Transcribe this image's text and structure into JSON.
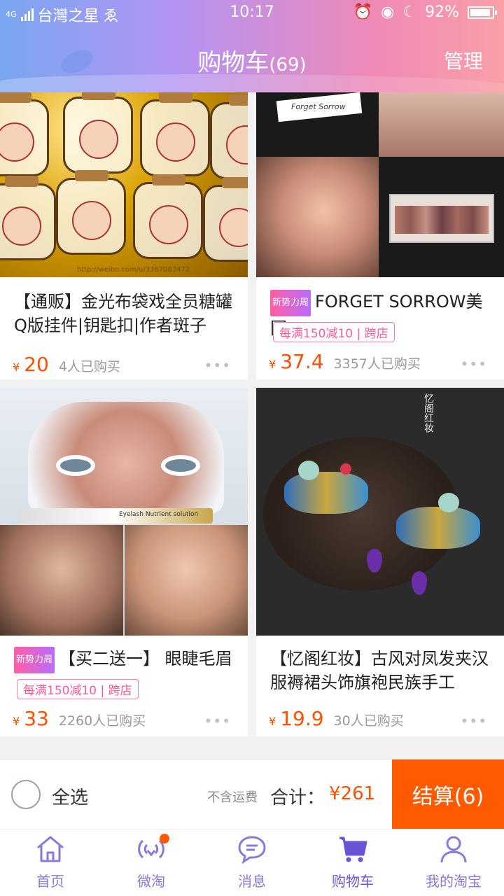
{
  "status": {
    "carrier": "台灣之星",
    "network": "4G",
    "time": "10:17",
    "battery": "92%",
    "battery_level": 0.92
  },
  "header": {
    "title": "购物车",
    "count": "(69)",
    "manage": "管理"
  },
  "items": [
    {
      "title": "【通贩】金光布袋戏全员糖罐Q版挂件|钥匙扣|作者斑子",
      "yen": "¥",
      "price": "20",
      "sold": "4人已购买",
      "new_tag": "",
      "promo": ""
    },
    {
      "title": "FORGET SORROW美国",
      "yen": "¥",
      "price": "37.4",
      "sold": "3357人已购买",
      "new_tag": "新势力周",
      "promo": "每满150减10 | 跨店"
    },
    {
      "title": "【买二送一】 眼睫毛眉",
      "yen": "¥",
      "price": "33",
      "sold": "2260人已购买",
      "new_tag": "新势力周",
      "promo": "每满150减10 | 跨店"
    },
    {
      "title": "【忆阁红妆】古风对凤发夹汉服褥裙头饰旗袍民族手工",
      "yen": "¥",
      "price": "19.9",
      "sold": "30人已购买",
      "new_tag": "",
      "promo": ""
    }
  ],
  "image_text": {
    "stickers_watermark": "http://weibo.com/u/3367083472",
    "makeup_brand": "Forget Sorrow",
    "lash_label": "Eyelash Nutrient solution",
    "earring_brand": "忆阁红妆"
  },
  "checkout": {
    "select_all": "全选",
    "shipping_note": "不含运费",
    "total_label": "合计：",
    "total": "¥261",
    "pay": "结算(6)"
  },
  "tabs": [
    {
      "label": "首页",
      "icon": "home-icon"
    },
    {
      "label": "微淘",
      "icon": "broadcast-icon"
    },
    {
      "label": "消息",
      "icon": "message-icon"
    },
    {
      "label": "购物车",
      "icon": "cart-icon"
    },
    {
      "label": "我的淘宝",
      "icon": "user-icon"
    }
  ],
  "colors": {
    "accent": "#ff5000",
    "pay_button": "#ff5a00",
    "tab": "#8a79d6"
  }
}
